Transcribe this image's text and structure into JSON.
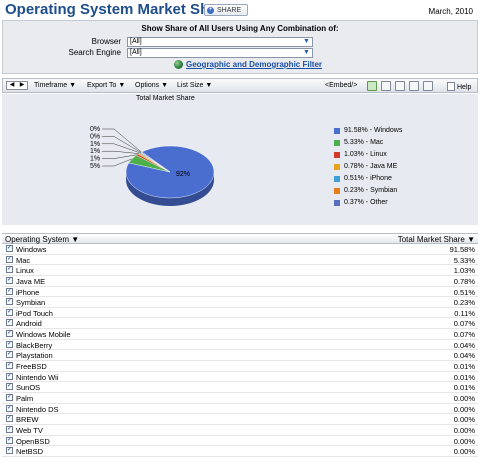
{
  "header": {
    "title": "Operating System Market Share",
    "share_label": "SHARE",
    "date": "March, 2010"
  },
  "filter": {
    "heading": "Show Share of All Users Using Any Combination of:",
    "browser_label": "Browser",
    "browser_value": "[All]",
    "engine_label": "Search Engine",
    "engine_value": "[All]",
    "geo_link": "Geographic and Demographic Filter"
  },
  "toolbar": {
    "timeframe": "Timeframe ▼",
    "export": "Export To ▼",
    "options": "Options ▼",
    "list_size": "List Size ▼",
    "embed": "<Embed/>",
    "help": "Help"
  },
  "chart_data": {
    "type": "pie",
    "title": "Total Market Share",
    "slices": [
      {
        "label": "Windows",
        "value": 91.58,
        "color": "#4a6ed0",
        "legend": "91.58% - Windows"
      },
      {
        "label": "Mac",
        "value": 5.33,
        "color": "#4db04a",
        "legend": "5.33% - Mac"
      },
      {
        "label": "Linux",
        "value": 1.03,
        "color": "#d23a2c",
        "legend": "1.03% - Linux"
      },
      {
        "label": "Java ME",
        "value": 0.78,
        "color": "#e8a21c",
        "legend": "0.78% - Java ME"
      },
      {
        "label": "iPhone",
        "value": 0.51,
        "color": "#3fa0d6",
        "legend": "0.51% - iPhone"
      },
      {
        "label": "Symbian",
        "value": 0.23,
        "color": "#e77d1b",
        "legend": "0.23% - Symbian"
      },
      {
        "label": "Other",
        "value": 0.37,
        "color": "#5a6ec0",
        "legend": "0.37% - Other"
      }
    ],
    "pie_labels": [
      "0%",
      "0%",
      "1%",
      "1%",
      "1%",
      "5%"
    ],
    "center_label": "92%"
  },
  "table": {
    "col_os": "Operating System ▼",
    "col_share": "Total Market Share ▼",
    "rows": [
      {
        "name": "Windows",
        "share": "91.58%"
      },
      {
        "name": "Mac",
        "share": "5.33%"
      },
      {
        "name": "Linux",
        "share": "1.03%"
      },
      {
        "name": "Java ME",
        "share": "0.78%"
      },
      {
        "name": "iPhone",
        "share": "0.51%"
      },
      {
        "name": "Symbian",
        "share": "0.23%"
      },
      {
        "name": "iPod Touch",
        "share": "0.11%"
      },
      {
        "name": "Android",
        "share": "0.07%"
      },
      {
        "name": "Windows Mobile",
        "share": "0.07%"
      },
      {
        "name": "BlackBerry",
        "share": "0.04%"
      },
      {
        "name": "Playstation",
        "share": "0.04%"
      },
      {
        "name": "FreeBSD",
        "share": "0.01%"
      },
      {
        "name": "Nintendo Wii",
        "share": "0.01%"
      },
      {
        "name": "SunOS",
        "share": "0.01%"
      },
      {
        "name": "Palm",
        "share": "0.00%"
      },
      {
        "name": "Nintendo DS",
        "share": "0.00%"
      },
      {
        "name": "BREW",
        "share": "0.00%"
      },
      {
        "name": "Web TV",
        "share": "0.00%"
      },
      {
        "name": "OpenBSD",
        "share": "0.00%"
      },
      {
        "name": "NetBSD",
        "share": "0.00%"
      }
    ]
  }
}
